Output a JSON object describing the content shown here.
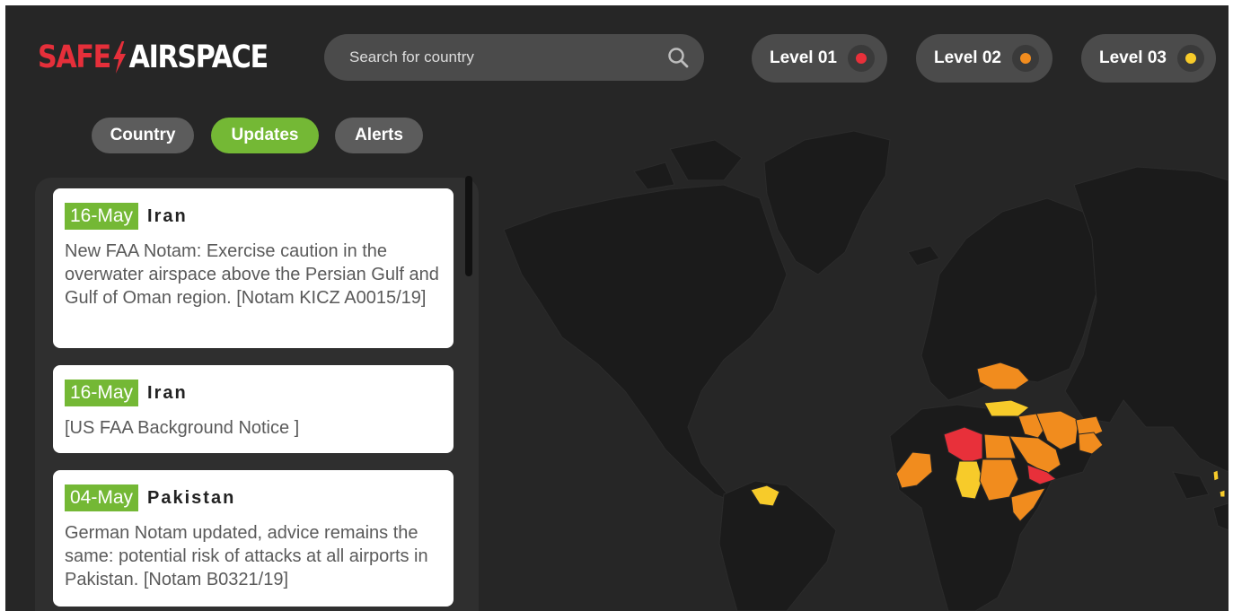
{
  "header": {
    "logo_left": "SAFE",
    "logo_right": "AIRSPACE",
    "search_placeholder": "Search for country",
    "levels": [
      {
        "label": "Level 01",
        "color": "#e8303a"
      },
      {
        "label": "Level 02",
        "color": "#f18c1e"
      },
      {
        "label": "Level 03",
        "color": "#f7cb2a"
      }
    ]
  },
  "tabs": [
    {
      "label": "Country",
      "active": false
    },
    {
      "label": "Updates",
      "active": true
    },
    {
      "label": "Alerts",
      "active": false
    }
  ],
  "updates": [
    {
      "date": "16-May",
      "country": "Iran",
      "text": "New FAA Notam: Exercise caution in the overwater airspace above the Persian Gulf and Gulf of Oman region. [Notam KICZ A0015/19]"
    },
    {
      "date": "16-May",
      "country": "Iran",
      "text": "[US FAA Background Notice ]"
    },
    {
      "date": "04-May",
      "country": "Pakistan",
      "text": "German Notam updated, advice remains the same: potential risk of attacks at all airports in Pakistan. [Notam B0321/19]"
    }
  ],
  "colors": {
    "accent_green": "#74b835",
    "brand_red": "#e52f3a",
    "background": "#262626",
    "map_land": "#1b1b1b"
  }
}
